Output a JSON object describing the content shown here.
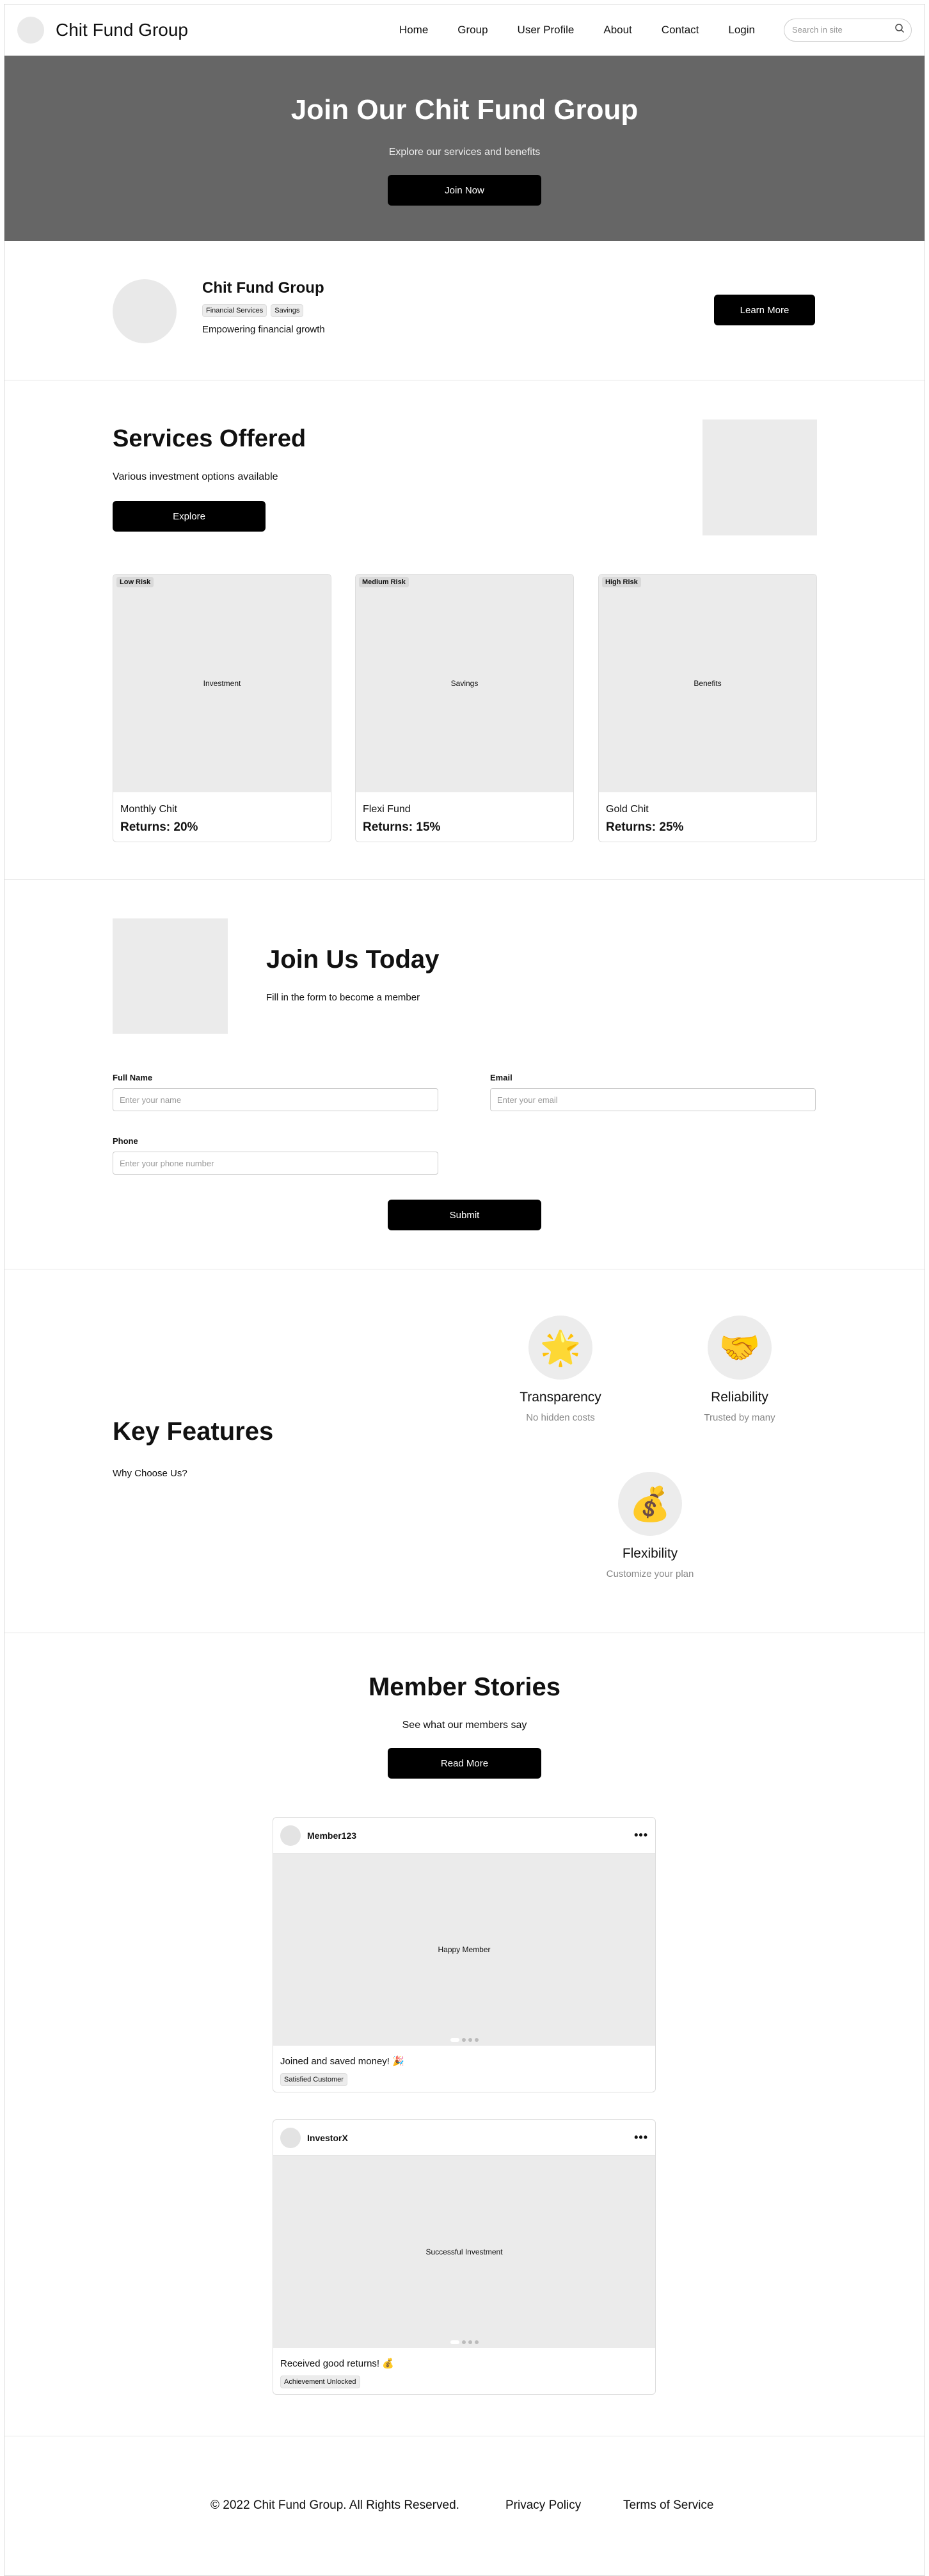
{
  "header": {
    "brand": "Chit Fund Group",
    "nav": [
      "Home",
      "Group",
      "User Profile",
      "About",
      "Contact",
      "Login"
    ],
    "search_placeholder": "Search in site"
  },
  "hero": {
    "title": "Join Our Chit Fund Group",
    "subtitle": "Explore our services and benefits",
    "button": "Join Now"
  },
  "profile": {
    "name": "Chit Fund Group",
    "tags": [
      "Financial Services",
      "Savings"
    ],
    "description": "Empowering financial growth",
    "button": "Learn More"
  },
  "services": {
    "title": "Services Offered",
    "subtitle": "Various investment options available",
    "button": "Explore",
    "cards": [
      {
        "risk": "Low Risk",
        "image_label": "Investment",
        "title": "Monthly Chit",
        "returns": "Returns: 20%"
      },
      {
        "risk": "Medium Risk",
        "image_label": "Savings",
        "title": "Flexi Fund",
        "returns": "Returns: 15%"
      },
      {
        "risk": "High Risk",
        "image_label": "Benefits",
        "title": "Gold Chit",
        "returns": "Returns: 25%"
      }
    ]
  },
  "join": {
    "title": "Join Us Today",
    "subtitle": "Fill in the form to become a member",
    "fields": {
      "name": {
        "label": "Full Name",
        "placeholder": "Enter your name"
      },
      "email": {
        "label": "Email",
        "placeholder": "Enter your email"
      },
      "phone": {
        "label": "Phone",
        "placeholder": "Enter your phone number"
      }
    },
    "button": "Submit"
  },
  "features": {
    "title": "Key Features",
    "subtitle": "Why Choose Us?",
    "items": [
      {
        "icon": "🌟",
        "icon_name": "star-icon",
        "title": "Transparency",
        "desc": "No hidden costs"
      },
      {
        "icon": "🤝",
        "icon_name": "handshake-icon",
        "title": "Reliability",
        "desc": "Trusted by many"
      },
      {
        "icon": "💰",
        "icon_name": "money-bag-icon",
        "title": "Flexibility",
        "desc": "Customize your plan"
      }
    ]
  },
  "stories": {
    "title": "Member Stories",
    "subtitle": "See what our members say",
    "button": "Read More",
    "posts": [
      {
        "user": "Member123",
        "more": "•••",
        "image_label": "Happy Member",
        "caption": "Joined and saved money! 🎉",
        "tag": "Satisfied Customer"
      },
      {
        "user": "InvestorX",
        "more": "•••",
        "image_label": "Successful Investment",
        "caption": "Received good returns! 💰",
        "tag": "Achievement Unlocked"
      }
    ]
  },
  "footer": {
    "copyright": "© 2022 Chit Fund Group. All Rights Reserved.",
    "privacy": "Privacy Policy",
    "terms": "Terms of Service"
  }
}
